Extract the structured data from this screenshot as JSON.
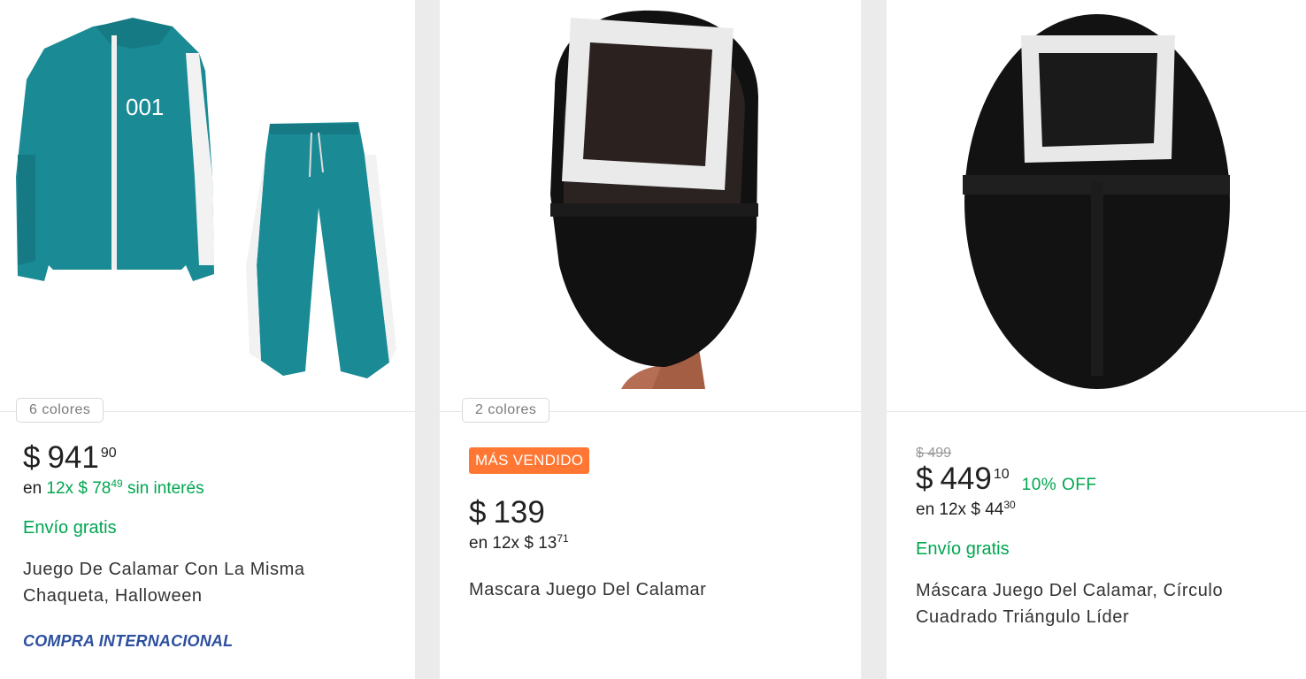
{
  "cards": [
    {
      "colors_label": "6 colores",
      "price": {
        "currency": "$",
        "integer": "941",
        "cents": "90"
      },
      "installments": {
        "prefix": "en",
        "qty": "12x",
        "currency": "$",
        "integer": "78",
        "cents": "49",
        "suffix": "sin interés"
      },
      "shipping": "Envío gratis",
      "title_line1": "Juego De Calamar Con La Misma",
      "title_line2": "Chaqueta, Halloween",
      "tag": "COMPRA INTERNACIONAL",
      "jacket_number": "001"
    },
    {
      "colors_label": "2 colores",
      "badge": "MÁS VENDIDO",
      "price": {
        "currency": "$",
        "integer": "139"
      },
      "installments": {
        "prefix": "en",
        "qty": "12x",
        "currency": "$",
        "integer": "13",
        "cents": "71"
      },
      "title_line1": "Mascara Juego Del Calamar"
    },
    {
      "original_price": "$ 499",
      "price": {
        "currency": "$",
        "integer": "449",
        "cents": "10"
      },
      "discount": "10% OFF",
      "installments": {
        "prefix": "en",
        "qty": "12x",
        "currency": "$",
        "integer": "44",
        "cents": "30"
      },
      "shipping": "Envío gratis",
      "title_line1": "Máscara Juego Del Calamar, Círculo",
      "title_line2": "Cuadrado Triángulo Líder"
    }
  ],
  "colors": {
    "teal": "#1a8a95",
    "green": "#00a650",
    "badge": "#ff7733",
    "intl_blue": "#2d4f9e"
  }
}
